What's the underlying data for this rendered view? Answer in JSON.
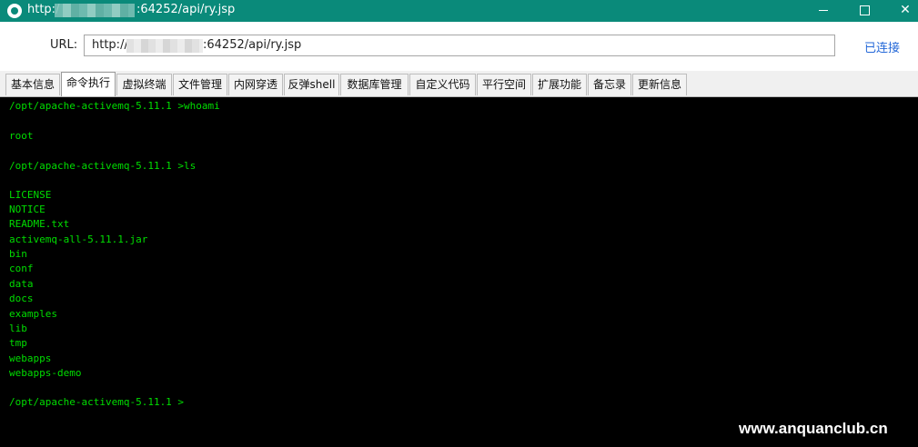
{
  "window": {
    "title_prefix": "http:/",
    "title_suffix": ":64252/api/ry.jsp",
    "icon": "globe-icon",
    "controls": [
      "minimize-icon",
      "maximize-icon",
      "close-icon"
    ],
    "colors": {
      "titlebar": "#0a8a7a"
    }
  },
  "url_bar": {
    "label": "URL:",
    "value_prefix": "http://",
    "value_suffix": ":64252/api/ry.jsp",
    "status": "已连接",
    "status_color": "#2468d8"
  },
  "tabs": [
    {
      "label": "基本信息"
    },
    {
      "label": "命令执行",
      "active": true
    },
    {
      "label": "虚拟终端"
    },
    {
      "label": "文件管理"
    },
    {
      "label": "内网穿透"
    },
    {
      "label": "反弹shell"
    },
    {
      "label": "数据库管理"
    },
    {
      "label": "自定义代码"
    },
    {
      "label": "平行空间"
    },
    {
      "label": "扩展功能"
    },
    {
      "label": "备忘录"
    },
    {
      "label": "更新信息"
    }
  ],
  "terminal": {
    "lines": [
      "/opt/apache-activemq-5.11.1 >whoami",
      "",
      "root",
      "",
      "/opt/apache-activemq-5.11.1 >ls",
      "",
      "LICENSE",
      "NOTICE",
      "README.txt",
      "activemq-all-5.11.1.jar",
      "bin",
      "conf",
      "data",
      "docs",
      "examples",
      "lib",
      "tmp",
      "webapps",
      "webapps-demo",
      "",
      "/opt/apache-activemq-5.11.1 >"
    ],
    "colors": {
      "background": "#000000",
      "text": "#00dd00"
    }
  },
  "watermark": "www.anquanclub.cn"
}
